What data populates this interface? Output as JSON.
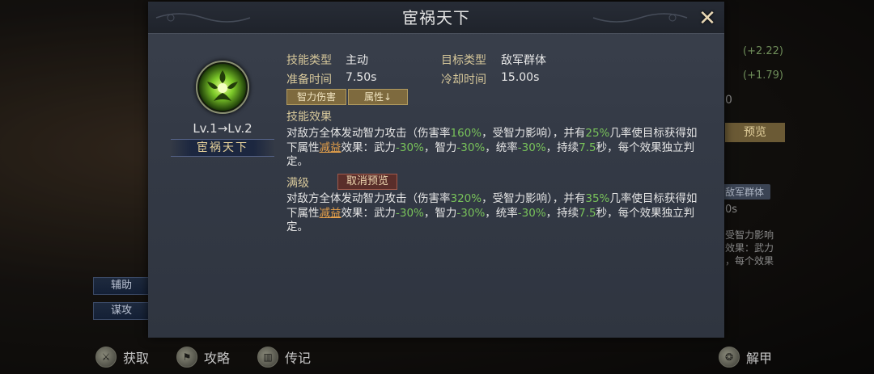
{
  "background": {
    "stats": [
      "(+2.22)",
      "(+1.79)"
    ],
    "partial_zero": "0",
    "preview_button": "预览",
    "target_tag": "敌军群体",
    "partial_cooldown": "0s",
    "partial_desc_lines": [
      "受智力影响",
      "效果：武力",
      "，每个效果"
    ],
    "side_buttons": [
      "辅助",
      "谋攻"
    ]
  },
  "bottom_bar": {
    "items": [
      {
        "label": "获取",
        "icon": "acquire-icon"
      },
      {
        "label": "攻略",
        "icon": "guide-icon"
      },
      {
        "label": "传记",
        "icon": "biography-icon"
      },
      {
        "label": "解甲",
        "icon": "armor-icon"
      }
    ]
  },
  "modal": {
    "title": "宦祸天下",
    "close_icon": "close-icon",
    "skill": {
      "level_text": "Lv.1→Lv.2",
      "name": "宦祸天下",
      "icon": "skill-emblem-icon"
    },
    "info": {
      "skill_type_label": "技能类型",
      "skill_type_value": "主动",
      "target_type_label": "目标类型",
      "target_type_value": "敌军群体",
      "prep_time_label": "准备时间",
      "prep_time_value": "7.50s",
      "cooldown_label": "冷却时间",
      "cooldown_value": "15.00s"
    },
    "tags": [
      "智力伤害",
      "属性↓"
    ],
    "effect_label": "技能效果",
    "effect": {
      "p1": "对敌方全体发动智力攻击（伤害率",
      "rate": "160%",
      "p2": "，受智力影响），并有",
      "chance": "25%",
      "p3": "几率使目标获得如下属性",
      "debuff": "减益",
      "p4": "效果：武力",
      "v1": "-30%",
      "p5": "，智力",
      "v2": "-30%",
      "p6": "，统率",
      "v3": "-30%",
      "p7": "，持续",
      "duration": "7.5",
      "p8": "秒，每个效果独立判定。"
    },
    "max_label": "满级",
    "cancel_preview": "取消预览",
    "max_effect": {
      "p1": "对敌方全体发动智力攻击（伤害率",
      "rate": "320%",
      "p2": "，受智力影响），并有",
      "chance": "35%",
      "p3": "几率使目标获得如下属性",
      "debuff": "减益",
      "p4": "效果：武力",
      "v1": "-30%",
      "p5": "，智力",
      "v2": "-30%",
      "p6": "，统率",
      "v3": "-30%",
      "p7": "，持续",
      "duration": "7.5",
      "p8": "秒，每个效果独立判定。"
    }
  }
}
